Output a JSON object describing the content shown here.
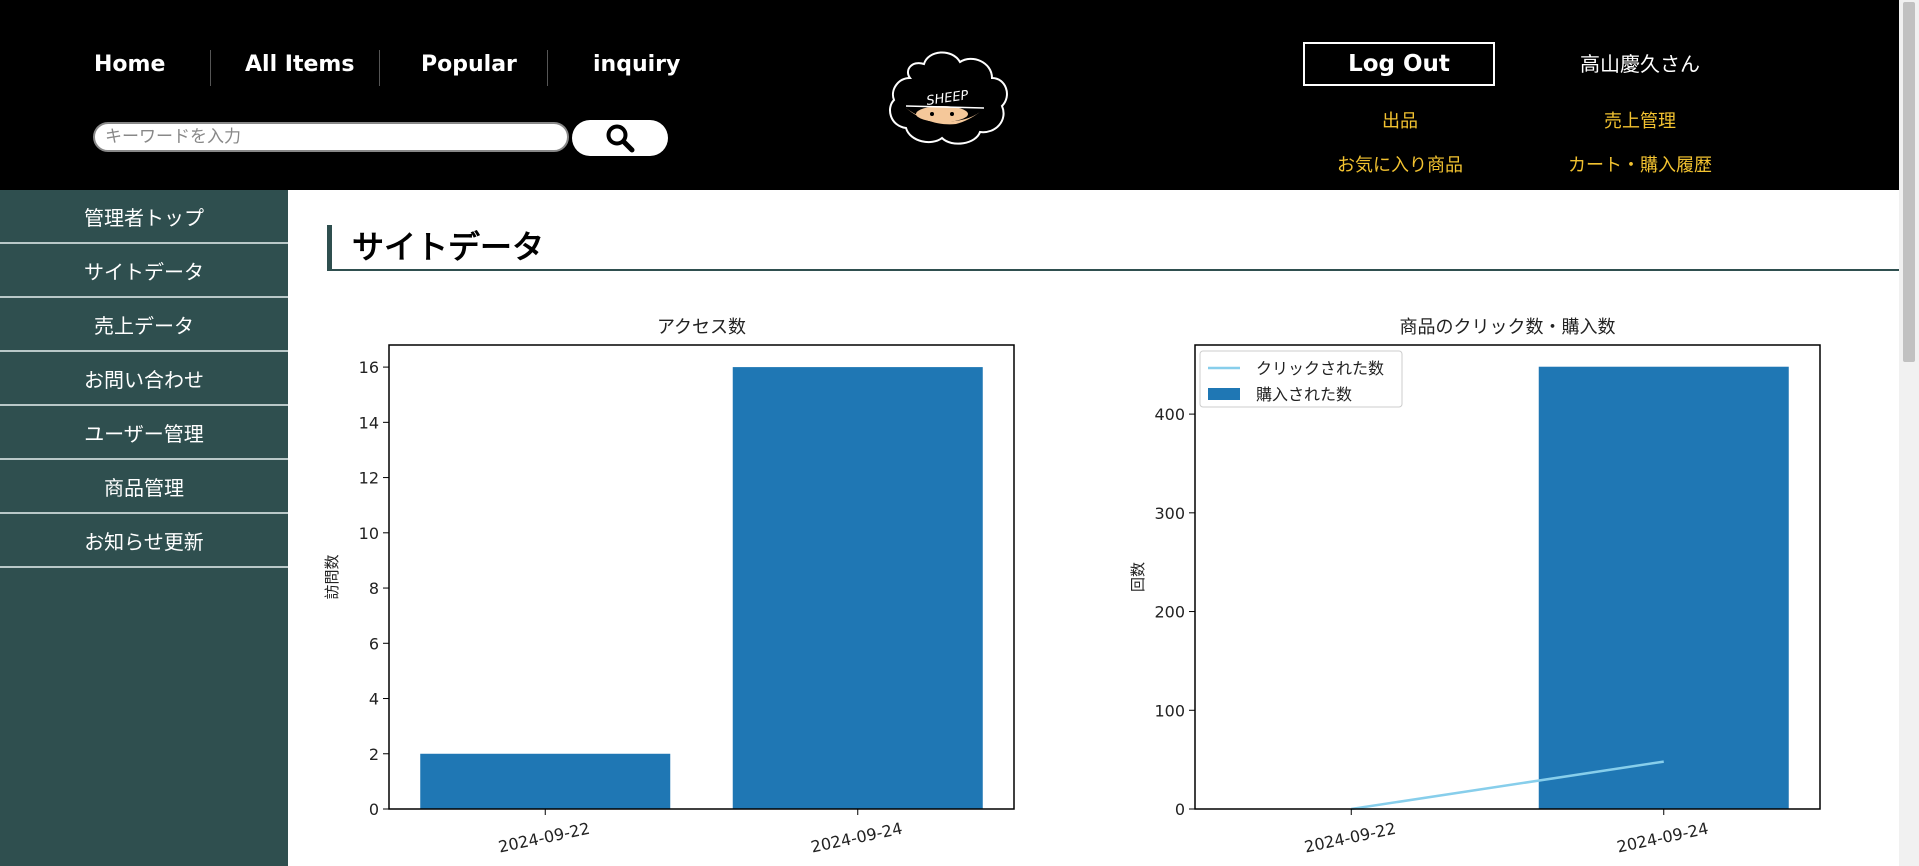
{
  "header": {
    "nav": [
      "Home",
      "All Items",
      "Popular",
      "inquiry"
    ],
    "search_placeholder": "キーワードを入力",
    "logo_text": "SHEEP",
    "logout_label": "Log Out",
    "user_name": "高山慶久さん",
    "links": [
      "出品",
      "売上管理",
      "お気に入り商品",
      "カート・購入履歴"
    ]
  },
  "sidebar": {
    "items": [
      "管理者トップ",
      "サイトデータ",
      "売上データ",
      "お問い合わせ",
      "ユーザー管理",
      "商品管理",
      "お知らせ更新"
    ]
  },
  "main": {
    "title": "サイトデータ"
  },
  "colors": {
    "bar": "#1f77b4",
    "line": "#87ceeb",
    "sidebar": "#2f4f4f",
    "link": "#f2c230"
  },
  "chart_data": [
    {
      "type": "bar",
      "title": "アクセス数",
      "xlabel": "",
      "ylabel": "訪問数",
      "categories": [
        "2024-09-22",
        "2024-09-24"
      ],
      "values": [
        2,
        16
      ],
      "ylim": [
        0,
        16.8
      ],
      "yticks": [
        0,
        2,
        4,
        6,
        8,
        10,
        12,
        14,
        16
      ]
    },
    {
      "type": "bar",
      "title": "商品のクリック数・購入数",
      "xlabel": "",
      "ylabel": "回数",
      "categories": [
        "2024-09-22",
        "2024-09-24"
      ],
      "series": [
        {
          "name": "クリックされた数",
          "type": "line",
          "values": [
            0,
            48
          ]
        },
        {
          "name": "購入された数",
          "type": "bar",
          "values": [
            0,
            448
          ]
        }
      ],
      "ylim": [
        0,
        470
      ],
      "yticks": [
        0,
        100,
        200,
        300,
        400
      ],
      "legend": "top-left"
    }
  ]
}
